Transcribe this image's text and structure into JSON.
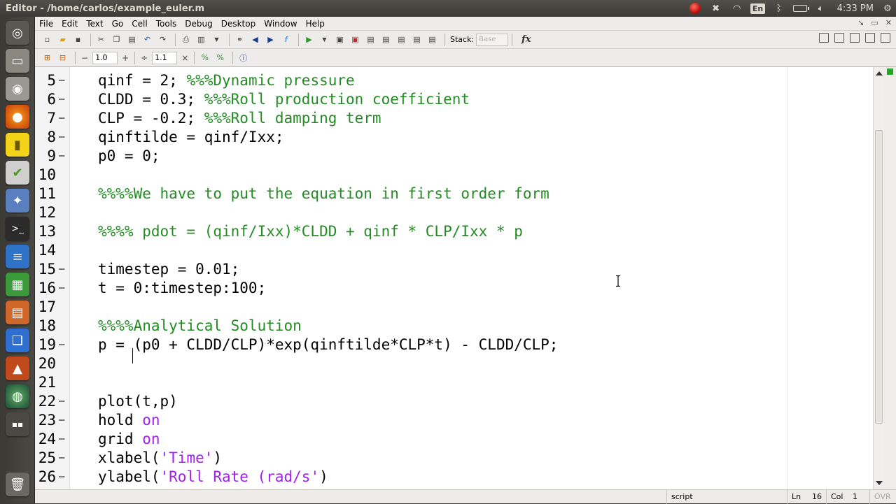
{
  "window": {
    "title": "Editor - /home/carlos/example_euler.m"
  },
  "panel": {
    "language": "En",
    "clock": "4:33 PM"
  },
  "menubar": {
    "items": [
      "File",
      "Edit",
      "Text",
      "Go",
      "Cell",
      "Tools",
      "Debug",
      "Desktop",
      "Window",
      "Help"
    ]
  },
  "toolbar": {
    "stack_label": "Stack:",
    "stack_value": "Base",
    "fx_label": "fx"
  },
  "cell_toolbar": {
    "minus": "−",
    "value1": "1.0",
    "plus": "+",
    "divide": "÷",
    "value2": "1.1",
    "times": "×"
  },
  "code": {
    "lines": [
      {
        "num": "5",
        "dash": "–",
        "text": "qinf = 2; ",
        "comment": "%%%Dynamic pressure"
      },
      {
        "num": "6",
        "dash": "–",
        "text": "CLDD = 0.3; ",
        "comment": "%%%Roll production coefficient"
      },
      {
        "num": "7",
        "dash": "–",
        "text": "CLP = -0.2; ",
        "comment": "%%%Roll damping term"
      },
      {
        "num": "8",
        "dash": "–",
        "text": "qinftilde = qinf/Ixx;",
        "comment": ""
      },
      {
        "num": "9",
        "dash": "–",
        "text": "p0 = 0;",
        "comment": ""
      },
      {
        "num": "10",
        "dash": "",
        "text": "",
        "comment": ""
      },
      {
        "num": "11",
        "dash": "",
        "text": "",
        "comment": "%%%%We have to put the equation in first order form"
      },
      {
        "num": "12",
        "dash": "",
        "text": "",
        "comment": ""
      },
      {
        "num": "13",
        "dash": "",
        "text": "",
        "comment": "%%%% pdot = (qinf/Ixx)*CLDD + qinf * CLP/Ixx * p"
      },
      {
        "num": "14",
        "dash": "",
        "text": "",
        "comment": ""
      },
      {
        "num": "15",
        "dash": "–",
        "text": "timestep = 0.01;",
        "comment": ""
      },
      {
        "num": "16",
        "dash": "–",
        "text": "t = 0:timestep:100;",
        "comment": ""
      },
      {
        "num": "17",
        "dash": "",
        "text": "",
        "comment": ""
      },
      {
        "num": "18",
        "dash": "",
        "text": "",
        "comment": "%%%%Analytical Solution"
      },
      {
        "num": "19",
        "dash": "–",
        "text": "p = (p0 + CLDD/CLP)*exp(qinftilde*CLP*t) - CLDD/CLP;",
        "comment": ""
      },
      {
        "num": "20",
        "dash": "",
        "text": "",
        "comment": ""
      },
      {
        "num": "21",
        "dash": "",
        "text": "",
        "comment": ""
      },
      {
        "num": "22",
        "dash": "–",
        "text": "plot(t,p)",
        "comment": ""
      },
      {
        "num": "23",
        "dash": "–",
        "text": "hold ",
        "kw": "on"
      },
      {
        "num": "24",
        "dash": "–",
        "text": "grid ",
        "kw": "on"
      },
      {
        "num": "25",
        "dash": "–",
        "text": "xlabel(",
        "str": "'Time'",
        "tail": ")"
      },
      {
        "num": "26",
        "dash": "–",
        "text": "ylabel(",
        "str": "'Roll Rate (rad/s'",
        "tail": ")"
      }
    ]
  },
  "status": {
    "mode": "script",
    "ln_label": "Ln",
    "ln_value": "16",
    "col_label": "Col",
    "col_value": "1",
    "ovr": "OVR"
  },
  "colors": {
    "comment": "#228b22",
    "string": "#a020f0",
    "keyword": "#a020f0"
  }
}
